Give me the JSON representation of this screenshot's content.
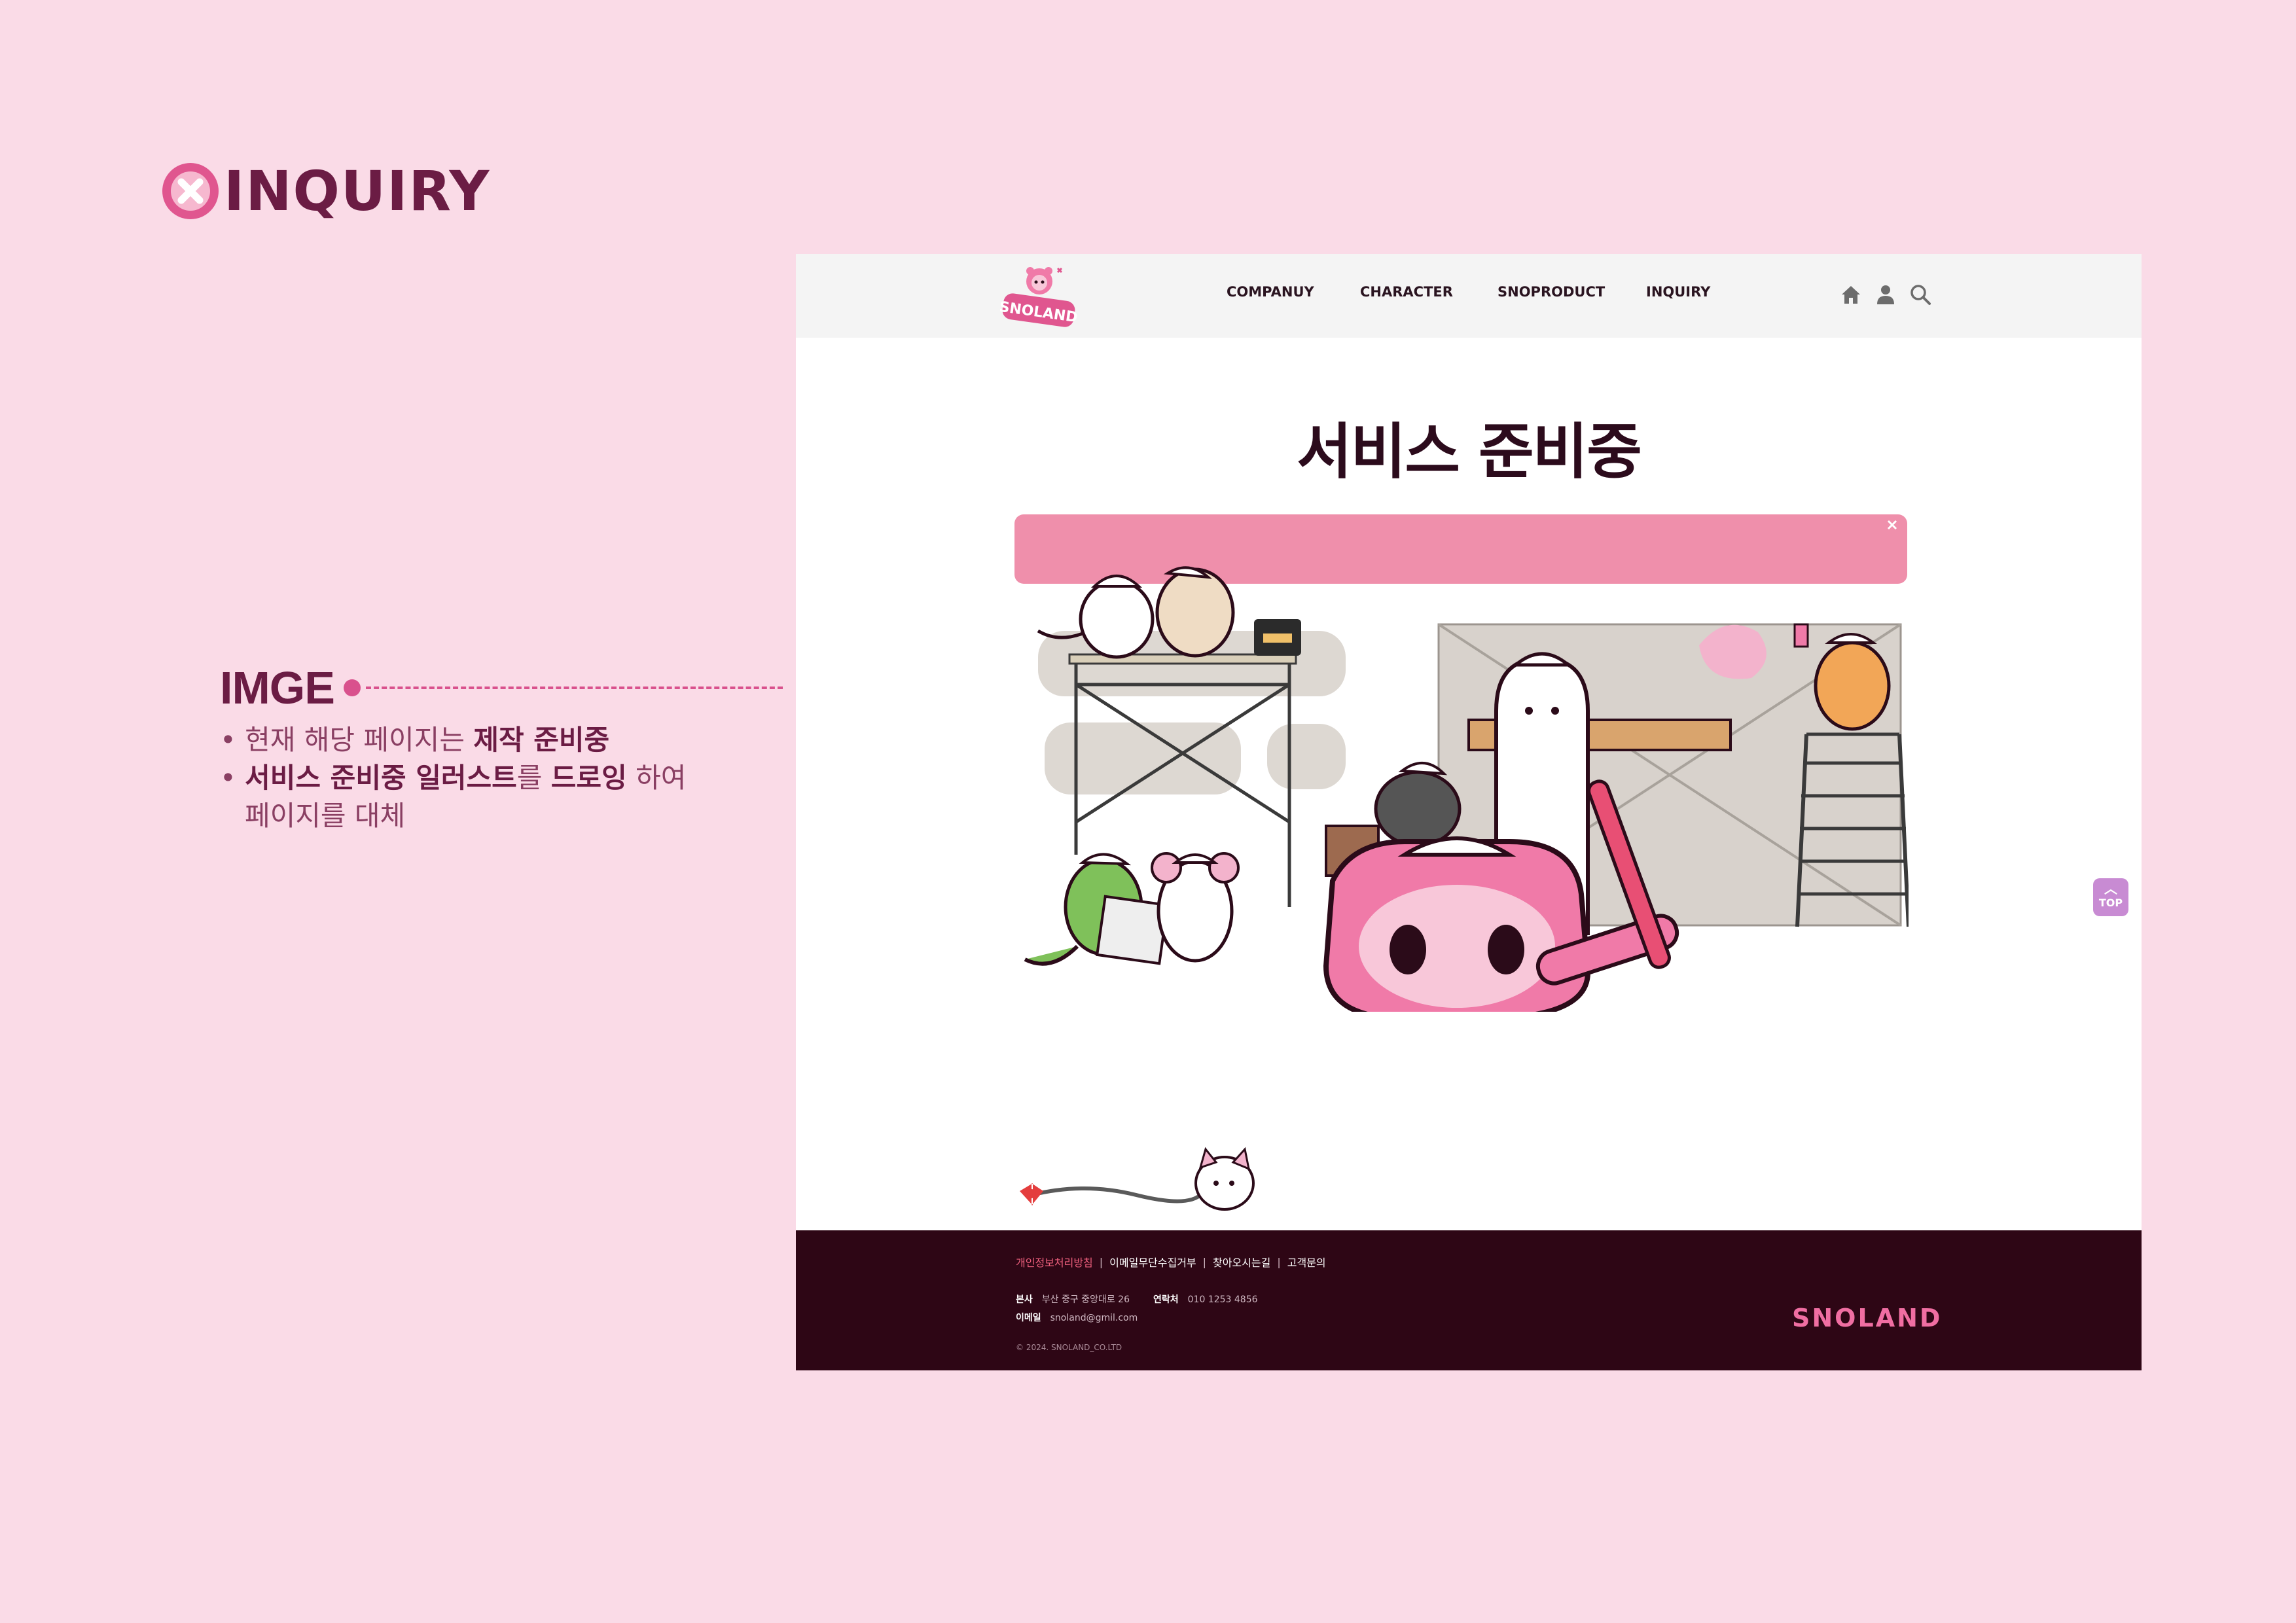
{
  "slide": {
    "title": "INQUIRY",
    "badge_icon": "x-circle-icon",
    "annotation": {
      "label": "IMGE",
      "lines": [
        {
          "bullet": "•",
          "pre": "현재 해당 페이지는 ",
          "strong": "제작 준비중",
          "post": ""
        },
        {
          "bullet": "•",
          "strong1": "서비스 준비중 일러스트",
          "mid": "를 ",
          "strong2": "드로잉",
          "post": " 하여"
        },
        {
          "cont": "페이지를 대체"
        }
      ]
    }
  },
  "site": {
    "nav": {
      "logo_text": "SNOLAND",
      "links": [
        "COMPANUY",
        "CHARACTER",
        "SNOPRODUCT",
        "INQUIRY"
      ],
      "icons": [
        "home-icon",
        "user-icon",
        "search-icon"
      ]
    },
    "heading": "서비스 준비중",
    "top_button": {
      "label": "TOP",
      "icon": "chevron-up-icon"
    },
    "footer": {
      "links": [
        "개인정보처리방침",
        "이메일무단수집거부",
        "찾아오시는길",
        "고객문의"
      ],
      "address_label": "본사",
      "address": "부산 중구 중앙대로 26",
      "phone_label": "연락처",
      "phone": "010 1253 4856",
      "email_label": "이메일",
      "email": "snoland@gmil.com",
      "copyright": "© 2024. SNOLAND_CO.LTD",
      "brand": "SNOLAND"
    }
  },
  "colors": {
    "slide_bg": "#fadbe7",
    "accent": "#d9518d",
    "dark_plum": "#6b1c44",
    "footer_bg": "#2e0615",
    "brand_pink": "#f06ea2",
    "banner_pink": "#ef8fab"
  }
}
